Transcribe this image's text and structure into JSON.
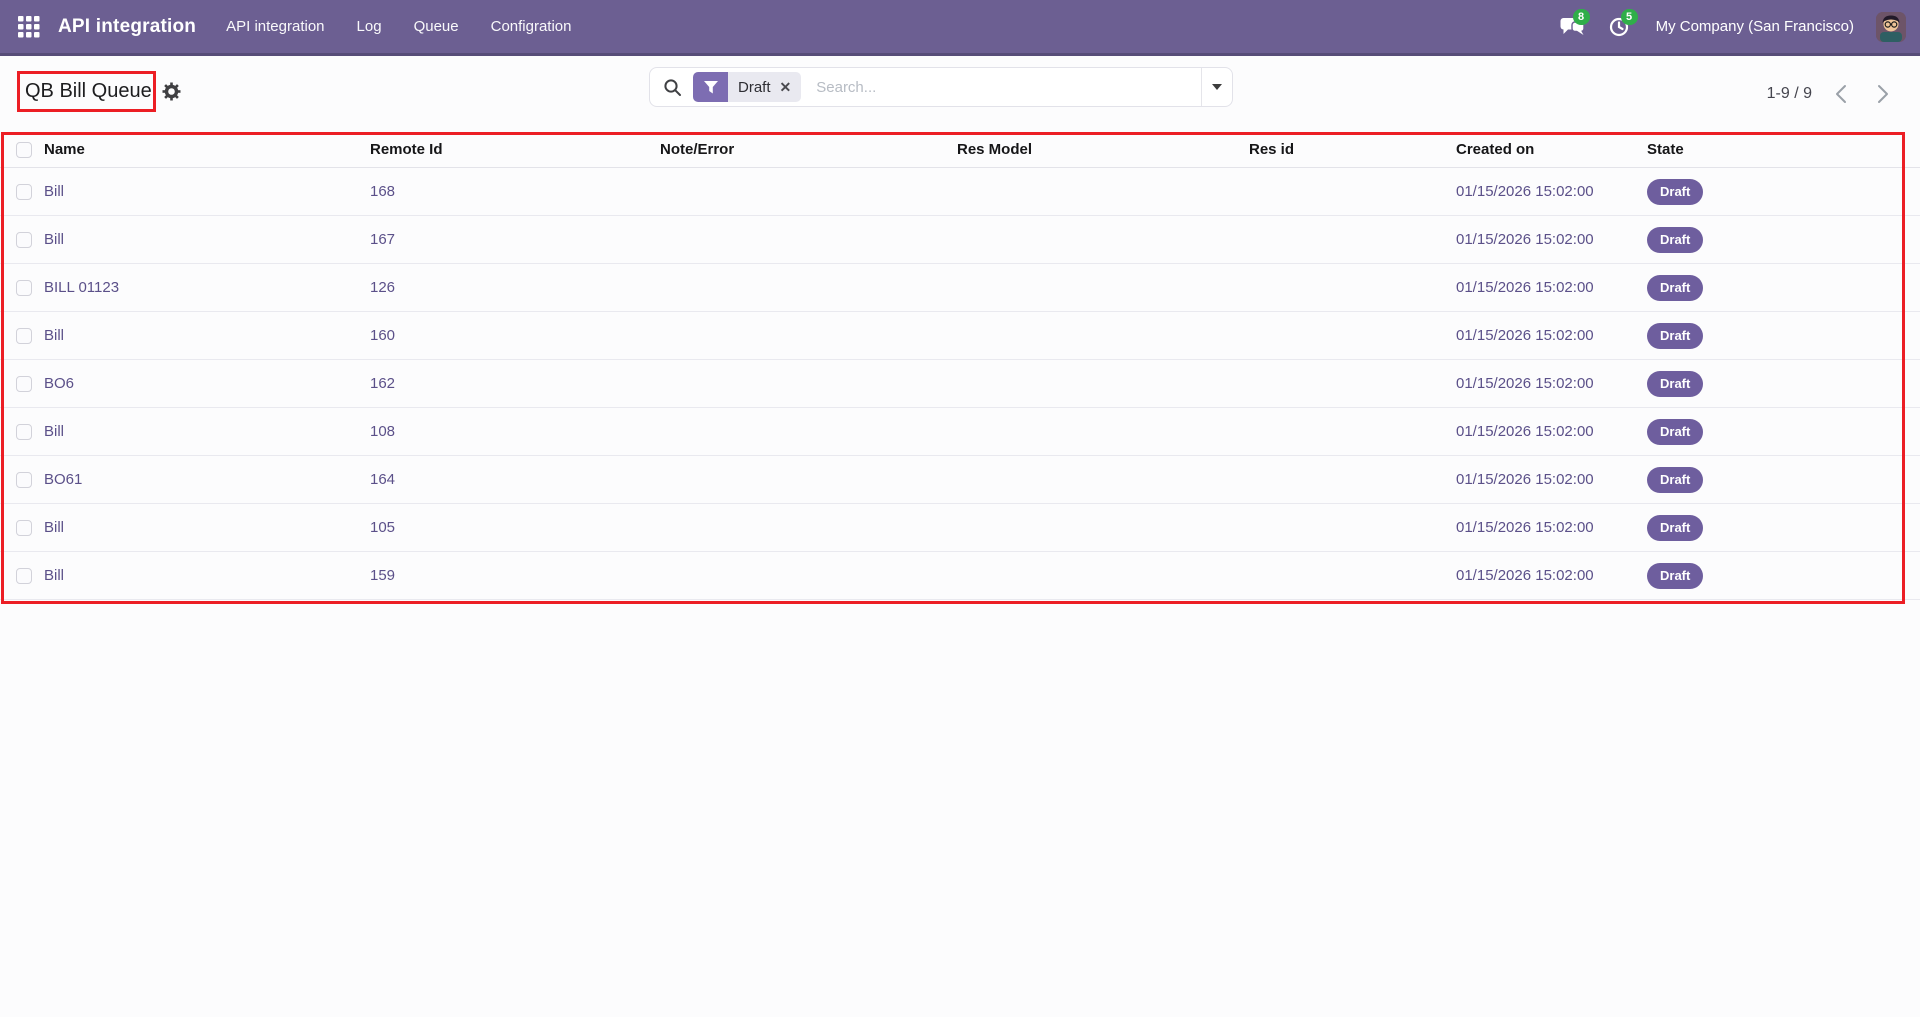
{
  "navbar": {
    "app_name": "API integration",
    "menu": [
      "API integration",
      "Log",
      "Queue",
      "Configration"
    ],
    "messages_badge": "8",
    "activities_badge": "5",
    "company_name": "My Company (San Francisco)"
  },
  "control_panel": {
    "title": "QB Bill Queue",
    "pager": "1-9 / 9",
    "search": {
      "filter": "Draft",
      "placeholder": "Search..."
    }
  },
  "table": {
    "headers": [
      "Name",
      "Remote Id",
      "Note/Error",
      "Res Model",
      "Res id",
      "Created on",
      "State"
    ],
    "rows": [
      {
        "name": "Bill",
        "remote_id": "168",
        "note_error": "",
        "res_model": "",
        "res_id": "",
        "created_on": "01/15/2026 15:02:00",
        "state": "Draft"
      },
      {
        "name": "Bill",
        "remote_id": "167",
        "note_error": "",
        "res_model": "",
        "res_id": "",
        "created_on": "01/15/2026 15:02:00",
        "state": "Draft"
      },
      {
        "name": "BILL 01123",
        "remote_id": "126",
        "note_error": "",
        "res_model": "",
        "res_id": "",
        "created_on": "01/15/2026 15:02:00",
        "state": "Draft"
      },
      {
        "name": "Bill",
        "remote_id": "160",
        "note_error": "",
        "res_model": "",
        "res_id": "",
        "created_on": "01/15/2026 15:02:00",
        "state": "Draft"
      },
      {
        "name": "BO6",
        "remote_id": "162",
        "note_error": "",
        "res_model": "",
        "res_id": "",
        "created_on": "01/15/2026 15:02:00",
        "state": "Draft"
      },
      {
        "name": "Bill",
        "remote_id": "108",
        "note_error": "",
        "res_model": "",
        "res_id": "",
        "created_on": "01/15/2026 15:02:00",
        "state": "Draft"
      },
      {
        "name": "BO61",
        "remote_id": "164",
        "note_error": "",
        "res_model": "",
        "res_id": "",
        "created_on": "01/15/2026 15:02:00",
        "state": "Draft"
      },
      {
        "name": "Bill",
        "remote_id": "105",
        "note_error": "",
        "res_model": "",
        "res_id": "",
        "created_on": "01/15/2026 15:02:00",
        "state": "Draft"
      },
      {
        "name": "Bill",
        "remote_id": "159",
        "note_error": "",
        "res_model": "",
        "res_id": "",
        "created_on": "01/15/2026 15:02:00",
        "state": "Draft"
      }
    ]
  },
  "colors": {
    "navbar_purple": "#6c5f92",
    "filter_purple": "#7d6db2",
    "state_badge_purple": "#6e5e9e",
    "row_link_purple": "#5b5089",
    "notification_green": "#2fae49",
    "annotation_red": "#ec1e24"
  }
}
